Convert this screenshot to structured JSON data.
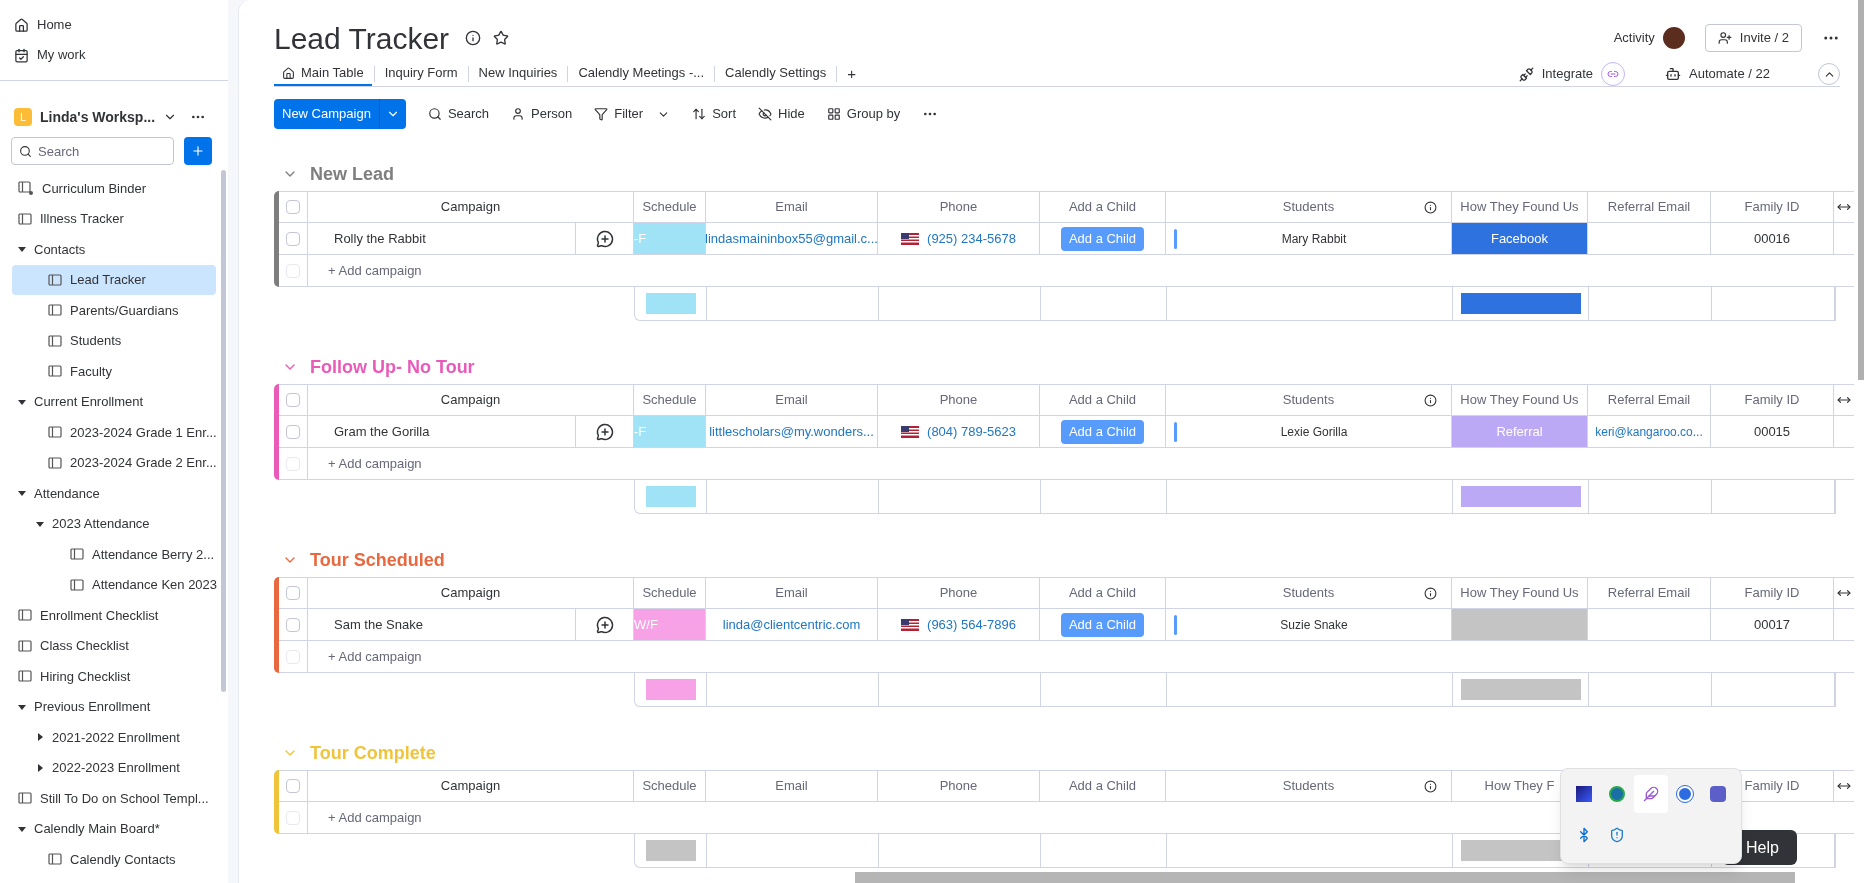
{
  "nav": [
    {
      "label": "Home",
      "kind": "home"
    },
    {
      "label": "My work",
      "kind": "work"
    }
  ],
  "workspace": {
    "initial": "L",
    "name": "Linda's Worksp..."
  },
  "sidebar_search": {
    "placeholder": "Search"
  },
  "sidebar": {
    "items": [
      {
        "label": "Curriculum Binder",
        "kind": "shared",
        "selected": false
      },
      {
        "label": "Illness Tracker",
        "kind": "board",
        "selected": false
      },
      {
        "label": "Contacts",
        "kind": "folder",
        "expanded": true,
        "selected": false,
        "children": [
          {
            "label": "Lead Tracker",
            "kind": "board",
            "selected": true
          },
          {
            "label": "Parents/Guardians",
            "kind": "board",
            "selected": false
          },
          {
            "label": "Students",
            "kind": "board",
            "selected": false
          },
          {
            "label": "Faculty",
            "kind": "board",
            "selected": false
          }
        ]
      },
      {
        "label": "Current Enrollment",
        "kind": "folder",
        "expanded": true,
        "selected": false,
        "children": [
          {
            "label": "2023-2024 Grade 1 Enr...",
            "kind": "board",
            "selected": false
          },
          {
            "label": "2023-2024 Grade 2 Enr...",
            "kind": "board",
            "selected": false
          }
        ]
      },
      {
        "label": "Attendance",
        "kind": "folder",
        "expanded": true,
        "selected": false,
        "children": [
          {
            "label": "2023 Attendance",
            "kind": "folder",
            "expanded": true,
            "selected": false,
            "children": [
              {
                "label": "Attendance Berry 2...",
                "kind": "board",
                "selected": false
              },
              {
                "label": "Attendance Ken 2023",
                "kind": "board",
                "selected": false
              }
            ]
          }
        ]
      },
      {
        "label": "Enrollment Checklist",
        "kind": "board",
        "selected": false
      },
      {
        "label": "Class Checklist",
        "kind": "board",
        "selected": false
      },
      {
        "label": "Hiring Checklist",
        "kind": "board",
        "selected": false
      },
      {
        "label": "Previous Enrollment",
        "kind": "folder",
        "expanded": true,
        "selected": false,
        "children": [
          {
            "label": "2021-2022 Enrollment",
            "kind": "folder",
            "expanded": false,
            "selected": false
          },
          {
            "label": "2022-2023 Enrollment",
            "kind": "folder",
            "expanded": false,
            "selected": false
          }
        ]
      },
      {
        "label": "Still To Do on School Templ...",
        "kind": "board",
        "selected": false
      },
      {
        "label": "Calendly Main Board*",
        "kind": "folder",
        "expanded": true,
        "selected": false,
        "children": [
          {
            "label": "Calendly Contacts",
            "kind": "board",
            "selected": false
          }
        ]
      }
    ]
  },
  "board": {
    "title": "Lead Tracker",
    "activity": "Activity",
    "invite": "Invite / 2"
  },
  "tabs": [
    {
      "label": "Main Table",
      "selected": true
    },
    {
      "label": "Inquiry Form",
      "selected": false
    },
    {
      "label": "New Inquiries",
      "selected": false
    },
    {
      "label": "Calendly Meetings -...",
      "selected": false
    },
    {
      "label": "Calendly Settings",
      "selected": false
    }
  ],
  "add_tab": "+",
  "integrate": "Integrate",
  "automate": "Automate / 22",
  "toolbar": {
    "primary": "New Campaign",
    "items": [
      {
        "label": "Search",
        "kind": "search"
      },
      {
        "label": "Person",
        "kind": "person"
      },
      {
        "label": "Filter",
        "kind": "filter"
      },
      {
        "label": "Sort",
        "kind": "sort"
      },
      {
        "label": "Hide",
        "kind": "hide"
      },
      {
        "label": "Group by",
        "kind": "group"
      }
    ]
  },
  "groups": [
    {
      "title": "New Lead",
      "color": "#7e7e7e",
      "checked": false,
      "columns": [
        {
          "kind": "campaign",
          "label": "Campaign"
        },
        {
          "kind": "schedule",
          "label": "Schedule"
        },
        {
          "kind": "email",
          "label": "Email"
        },
        {
          "kind": "phone",
          "label": "Phone"
        },
        {
          "kind": "child",
          "label": "Add a Child"
        },
        {
          "kind": "students",
          "label": "Students"
        },
        {
          "kind": "found",
          "label": "How They Found Us"
        },
        {
          "kind": "referral",
          "label": "Referral Email"
        },
        {
          "kind": "family",
          "label": "Family ID"
        }
      ],
      "rows": [
        {
          "checked": false,
          "campaign": "Rolly the Rabbit",
          "schedule": {
            "label": "-F",
            "color": "#a1e3f6"
          },
          "email": "lindasmaininbox55@gmail.c...",
          "phone": "(925) 234-5678",
          "child_button": "Add a Child",
          "students": "Mary Rabbit",
          "found": {
            "label": "Facebook",
            "color": "#2d72de"
          },
          "family_id": "00016"
        }
      ],
      "add_label": "+ Add campaign",
      "add_disabled": true,
      "summary": [
        {
          "kind": "schedule",
          "color": "#a1e3f6"
        },
        {
          "kind": "found",
          "color": "#2d72de"
        }
      ]
    },
    {
      "title": "Follow Up- No Tour",
      "color": "#e95ab9",
      "checked": false,
      "columns": [
        {
          "kind": "campaign",
          "label": "Campaign"
        },
        {
          "kind": "schedule",
          "label": "Schedule"
        },
        {
          "kind": "email",
          "label": "Email"
        },
        {
          "kind": "phone",
          "label": "Phone"
        },
        {
          "kind": "child",
          "label": "Add a Child"
        },
        {
          "kind": "students",
          "label": "Students"
        },
        {
          "kind": "found",
          "label": "How They Found Us"
        },
        {
          "kind": "referral",
          "label": "Referral Email"
        },
        {
          "kind": "family",
          "label": "Family ID"
        }
      ],
      "rows": [
        {
          "checked": false,
          "campaign": "Gram the Gorilla",
          "schedule": {
            "label": "-F",
            "color": "#a1e3f6"
          },
          "email": "littlescholars@my.wonders...",
          "phone": "(804) 789-5623",
          "child_button": "Add a Child",
          "students": "Lexie Gorilla",
          "found": {
            "label": "Referral",
            "color": "#bca9f5"
          },
          "referral": "keri@kangaroo.co...",
          "family_id": "00015"
        }
      ],
      "add_label": "+ Add campaign",
      "add_disabled": true,
      "summary": [
        {
          "kind": "schedule",
          "color": "#a1e3f6"
        },
        {
          "kind": "found",
          "color": "#bca9f5"
        }
      ]
    },
    {
      "title": "Tour Scheduled",
      "color": "#e8683f",
      "checked": false,
      "columns": [
        {
          "kind": "campaign",
          "label": "Campaign"
        },
        {
          "kind": "schedule",
          "label": "Schedule"
        },
        {
          "kind": "email",
          "label": "Email"
        },
        {
          "kind": "phone",
          "label": "Phone"
        },
        {
          "kind": "child",
          "label": "Add a Child"
        },
        {
          "kind": "students",
          "label": "Students"
        },
        {
          "kind": "found",
          "label": "How They Found Us"
        },
        {
          "kind": "referral",
          "label": "Referral Email"
        },
        {
          "kind": "family",
          "label": "Family ID"
        }
      ],
      "rows": [
        {
          "checked": false,
          "campaign": "Sam the Snake",
          "schedule": {
            "label": "W/F",
            "color": "#f7a1e6"
          },
          "email": "linda@clientcentric.com",
          "phone": "(963) 564-7896",
          "child_button": "Add a Child",
          "students": "Suzie Snake",
          "found": {
            "color": "#c4c4c4"
          },
          "family_id": "00017"
        }
      ],
      "add_label": "+ Add campaign",
      "add_disabled": true,
      "summary": [
        {
          "kind": "schedule",
          "color": "#f7a1e6"
        },
        {
          "kind": "found",
          "color": "#c4c4c4"
        }
      ]
    },
    {
      "title": "Tour Complete",
      "color": "#f0c43a",
      "checked": false,
      "columns": [
        {
          "kind": "campaign",
          "label": "Campaign"
        },
        {
          "kind": "schedule",
          "label": "Schedule"
        },
        {
          "kind": "email",
          "label": "Email"
        },
        {
          "kind": "phone",
          "label": "Phone"
        },
        {
          "kind": "child",
          "label": "Add a Child"
        },
        {
          "kind": "students",
          "label": "Students"
        },
        {
          "kind": "found",
          "label": "How They F"
        },
        {
          "kind": "family",
          "label": "Family ID"
        }
      ],
      "add_label": "+ Add campaign",
      "add_disabled": true,
      "summary": [
        {
          "kind": "schedule",
          "color": "#c4c4c4"
        },
        {
          "kind": "found",
          "color": "#c4c4c4"
        }
      ]
    }
  ],
  "help": "Help"
}
